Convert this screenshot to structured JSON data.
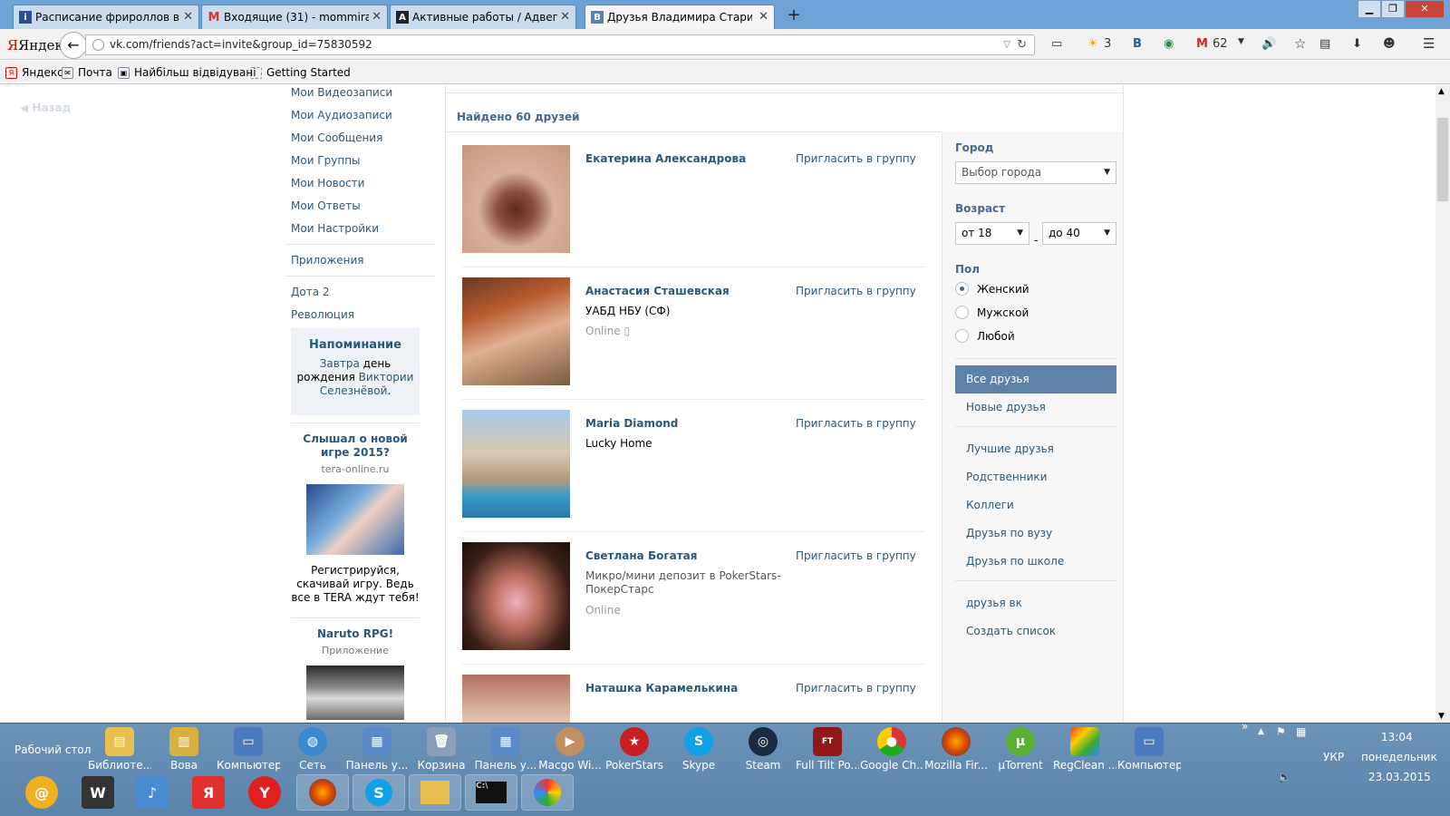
{
  "browser": {
    "tabs": [
      {
        "title": "Расписание фрироллов в...",
        "icon": "info-icon",
        "active": false
      },
      {
        "title": "Входящие (31) - mommira...",
        "icon": "gmail-icon",
        "active": false
      },
      {
        "title": "Активные работы / Адвег...",
        "icon": "advego-icon",
        "active": false
      },
      {
        "title": "Друзья Владимира Стари...",
        "icon": "vk-icon",
        "active": true
      }
    ],
    "yandex_logo": "Яндекс",
    "url": "vk.com/friends?act=invite&group_id=75830592",
    "weather": "3",
    "mail_count": "62",
    "bookmarks": [
      "Яндекс",
      "Почта",
      "Найбільш відвідувані",
      "Getting Started"
    ]
  },
  "page": {
    "back": "Назад",
    "left_menu": [
      "Мои Видеозаписи",
      "Мои Аудиозаписи",
      "Мои Сообщения",
      "Мои Группы",
      "Мои Новости",
      "Мои Ответы",
      "Мои Настройки"
    ],
    "left_menu_2": [
      "Приложения"
    ],
    "left_menu_3": [
      "Дота 2",
      "Революция"
    ],
    "reminder": {
      "title": "Напоминание",
      "link1": "Завтра",
      "text1": " день рождения ",
      "link2": "Виктории Селезнёвой",
      "text2": "."
    },
    "ad1": {
      "title": "Слышал о новой игре 2015?",
      "site": "tera-online.ru",
      "text": "Регистрируйся, скачивай игру. Ведь все в TERA ждут тебя!"
    },
    "ad2": {
      "title": "Naruto RPG!",
      "sub": "Приложение"
    },
    "found": "Найдено 60 друзей",
    "invite_label": "Пригласить в группу",
    "friends": [
      {
        "name": "Екатерина Александрова",
        "line1": "",
        "online": ""
      },
      {
        "name": "Анастасия Сташевская",
        "line1": "УАБД НБУ (СФ)",
        "online": "Online"
      },
      {
        "name": "Maria Diamond",
        "line1": "Lucky Home",
        "online": ""
      },
      {
        "name": "Светлана Богатая",
        "line1": "Микро/мини депозит в PokerStars-ПокерСтарс",
        "online": "Online"
      },
      {
        "name": "Наташка Карамелькина",
        "line1": "",
        "online": ""
      }
    ],
    "filters": {
      "city_label": "Город",
      "city_placeholder": "Выбор города",
      "age_label": "Возраст",
      "age_from": "от 18",
      "age_to": "до 40",
      "sex_label": "Пол",
      "sex_options": [
        "Женский",
        "Мужской",
        "Любой"
      ],
      "lists1": [
        "Все друзья",
        "Новые друзья"
      ],
      "lists2": [
        "Лучшие друзья",
        "Родственники",
        "Коллеги",
        "Друзья по вузу",
        "Друзья по школе"
      ],
      "lists3": [
        "друзья вк",
        "Создать список"
      ]
    }
  },
  "taskbar": {
    "desktop": "Рабочий стол",
    "items": [
      "Библиоте...",
      "Вова",
      "Компьютер",
      "Сеть",
      "Панель у...",
      "Корзина",
      "Панель у...",
      "Macgo Wi...",
      "PokerStars",
      "Skype",
      "Steam",
      "Full Tilt Po...",
      "Google Ch...",
      "Mozilla Fir...",
      "µTorrent",
      "RegClean ...",
      "Компьютер"
    ],
    "lang": "УКР",
    "time": "13:04",
    "day": "понедельник",
    "date": "23.03.2015"
  },
  "colors": {
    "vk_blue": "#2b587a",
    "vk_accent": "#5e81a8",
    "taskbar": "#5b84ab"
  }
}
